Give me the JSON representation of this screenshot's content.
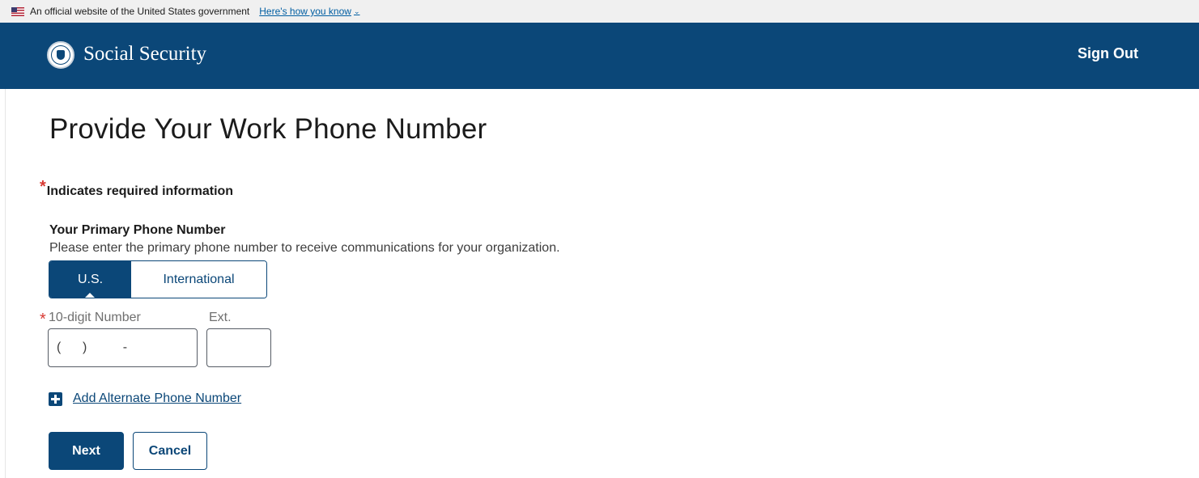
{
  "gov_banner": {
    "text": "An official website of the United States government",
    "link": "Here's how you know",
    "link_icon": "chevron-down-icon"
  },
  "header": {
    "brand": "Social Security",
    "logo_icon": "ssa-seal-icon",
    "sign_out": "Sign Out",
    "background_color": "#0b4778"
  },
  "page": {
    "title": "Provide Your Work Phone Number"
  },
  "required_note": {
    "star": "*",
    "text": "Indicates required information",
    "star_color": "#d83933"
  },
  "phone_section": {
    "label": "Your Primary Phone Number",
    "hint": "Please enter the primary phone number to receive communications for your organization.",
    "toggle": {
      "options": [
        "U.S.",
        "International"
      ],
      "selected": "U.S."
    },
    "number_field": {
      "required_star": "*",
      "label": "10-digit Number",
      "value": "(      )          -"
    },
    "ext_field": {
      "label": "Ext.",
      "value": ""
    }
  },
  "add_alternate": {
    "icon": "plus-square-icon",
    "label": "Add Alternate Phone Number"
  },
  "actions": {
    "next_label": "Next",
    "cancel_label": "Cancel"
  }
}
